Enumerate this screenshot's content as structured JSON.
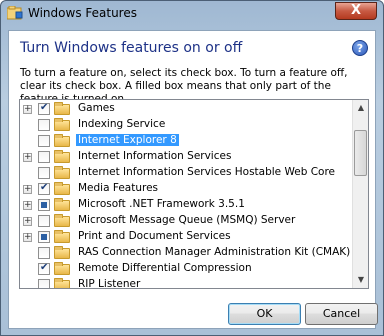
{
  "window": {
    "title": "Windows Features",
    "close_glyph": "X"
  },
  "heading": "Turn Windows features on or off",
  "help_glyph": "?",
  "description": "To turn a feature on, select its check box. To turn a feature off, clear its check box. A filled box means that only part of the feature is turned on.",
  "features": [
    {
      "label": "Games",
      "state": "checked",
      "expandable": true
    },
    {
      "label": "Indexing Service",
      "state": "unchecked",
      "expandable": false
    },
    {
      "label": "Internet Explorer 8",
      "state": "unchecked",
      "expandable": false,
      "selected": true
    },
    {
      "label": "Internet Information Services",
      "state": "unchecked",
      "expandable": true
    },
    {
      "label": "Internet Information Services Hostable Web Core",
      "state": "unchecked",
      "expandable": false
    },
    {
      "label": "Media Features",
      "state": "checked",
      "expandable": true
    },
    {
      "label": "Microsoft .NET Framework 3.5.1",
      "state": "partial",
      "expandable": true
    },
    {
      "label": "Microsoft Message Queue (MSMQ) Server",
      "state": "unchecked",
      "expandable": true
    },
    {
      "label": "Print and Document Services",
      "state": "partial",
      "expandable": true
    },
    {
      "label": "RAS Connection Manager Administration Kit (CMAK)",
      "state": "unchecked",
      "expandable": false
    },
    {
      "label": "Remote Differential Compression",
      "state": "checked",
      "expandable": false
    },
    {
      "label": "RIP Listener",
      "state": "unchecked",
      "expandable": false
    }
  ],
  "scroll": {
    "up_glyph": "▲",
    "down_glyph": "▼"
  },
  "buttons": {
    "ok": "OK",
    "cancel": "Cancel"
  },
  "colors": {
    "heading": "#1e3287",
    "selection": "#3399ff"
  }
}
